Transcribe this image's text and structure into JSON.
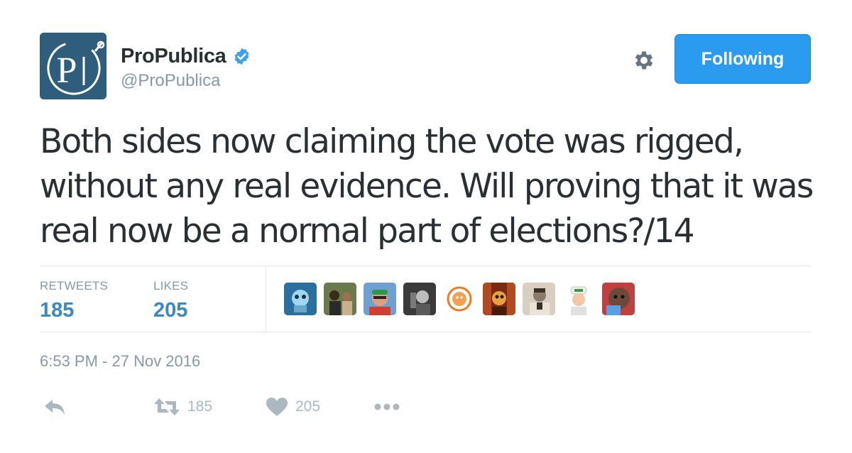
{
  "tweet": {
    "display_name": "ProPublica",
    "handle": "@ProPublica",
    "follow_label": "Following",
    "text_lines": [
      "Both sides now claiming the vote was rigged,",
      "without any real evidence. Will proving that it was",
      "real now be a normal part of elections?/14"
    ],
    "timestamp": "6:53 PM - 27 Nov 2016"
  },
  "stats": {
    "retweets_label": "RETWEETS",
    "retweets_value": "185",
    "likes_label": "LIKES",
    "likes_value": "205"
  },
  "actions": {
    "retweet_count": "185",
    "like_count": "205"
  },
  "icons": {
    "logo": "propublica-logo",
    "verified": "verified-badge-icon",
    "gear": "gear-icon",
    "reply": "reply-icon",
    "retweet": "retweet-icon",
    "like": "heart-icon",
    "more": "more-icon"
  },
  "colors": {
    "follow_button": "#2b9bf0",
    "stat_value": "#3b88c3",
    "muted": "#8899a6",
    "logo_bg": "#2f5d7c"
  },
  "avatars": [
    {
      "name": "avatar-1",
      "bg": "#2a6f9e"
    },
    {
      "name": "avatar-2",
      "bg": "#5b4a3a"
    },
    {
      "name": "avatar-3",
      "bg": "#c0563a"
    },
    {
      "name": "avatar-4",
      "bg": "#4a4a4a"
    },
    {
      "name": "avatar-5",
      "bg": "#ffffff"
    },
    {
      "name": "avatar-6",
      "bg": "#8a3a1e"
    },
    {
      "name": "avatar-7",
      "bg": "#a89a86"
    },
    {
      "name": "avatar-8",
      "bg": "#f2ede4"
    },
    {
      "name": "avatar-9",
      "bg": "#6b4a3a"
    }
  ]
}
